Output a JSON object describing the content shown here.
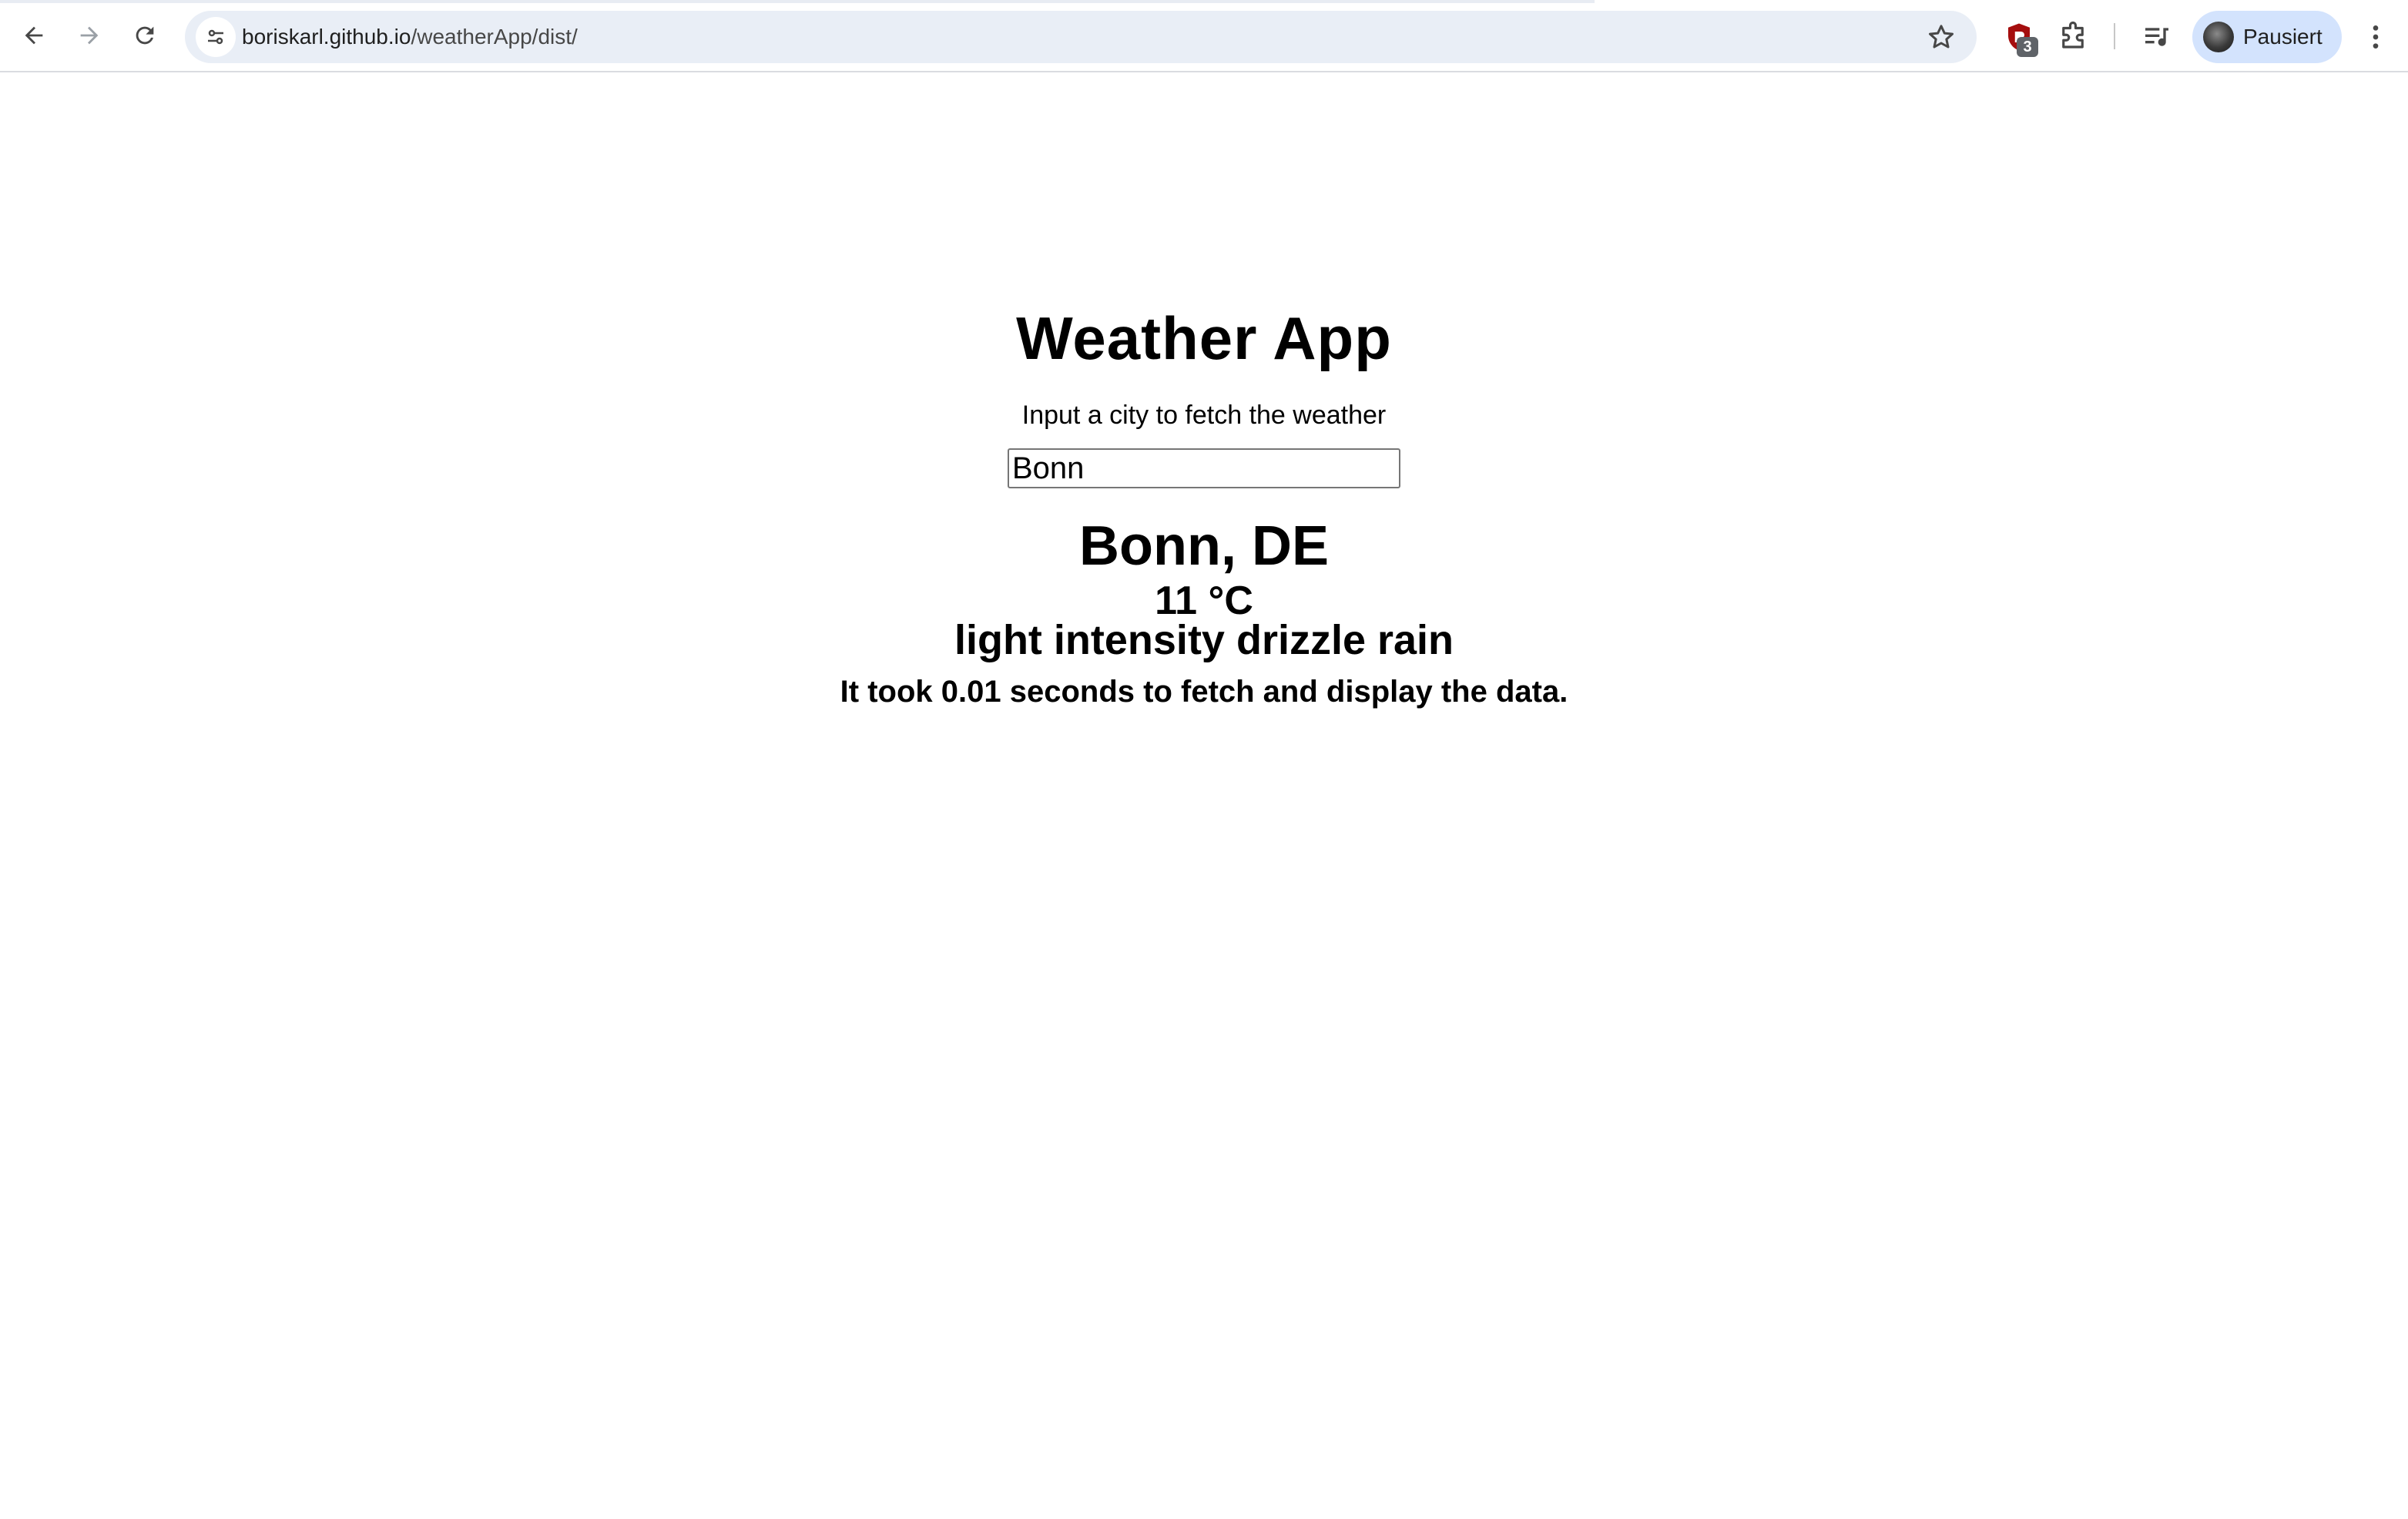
{
  "browser": {
    "url_host": "boriskarl.github.io",
    "url_path": "/weatherApp/dist/",
    "extension_badge": "3",
    "profile_label": "Pausiert",
    "icons": {
      "back": "arrow-left-icon",
      "forward": "arrow-right-icon",
      "reload": "reload-icon",
      "site_info": "tune-icon",
      "bookmark": "star-icon",
      "extension": "shield-icon",
      "extensions_menu": "puzzle-icon",
      "media": "media-control-icon",
      "menu": "kebab-menu-icon"
    }
  },
  "app": {
    "title": "Weather App",
    "prompt": "Input a city to fetch the weather",
    "city_input_value": "Bonn",
    "location": "Bonn, DE",
    "temperature": "11 °C",
    "description": "light intensity drizzle rain",
    "timing": "It took 0.01 seconds to fetch and display the data."
  },
  "colors": {
    "omnibox_bg": "#e9eef6",
    "profile_bg": "#d3e3fd",
    "extension_red": "#a50e0e",
    "text": "#000000"
  }
}
